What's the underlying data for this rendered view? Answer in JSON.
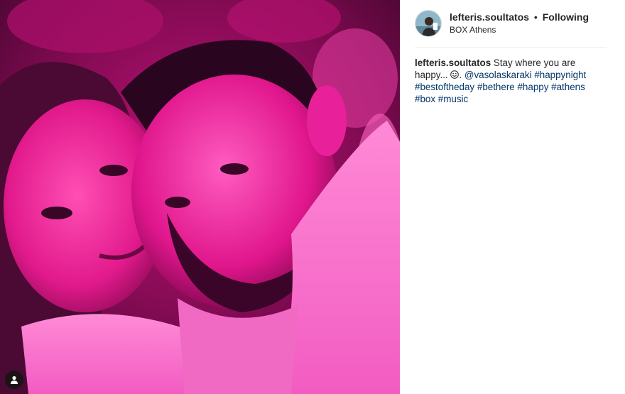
{
  "post": {
    "author": {
      "username": "lefteris.soultatos",
      "follow_state": "Following",
      "separator": "•",
      "location": "BOX Athens",
      "avatar_icon": "profile-photo"
    },
    "caption": {
      "username": "lefteris.soultatos",
      "text_1": "Stay where you are happy...",
      "emoji": "smiling-face-icon",
      "text_2": ".",
      "mention": "@vasolaskaraki",
      "hashtags": [
        "#happynight",
        "#bestoftheday",
        "#bethere",
        "#happy",
        "#athens",
        "#box",
        "#music"
      ]
    },
    "photo": {
      "description_icon": "user-tags-icon"
    },
    "colors": {
      "link": "#003569",
      "text": "#262626",
      "divider": "#efefef",
      "photo_tint": "#e0148c"
    }
  }
}
